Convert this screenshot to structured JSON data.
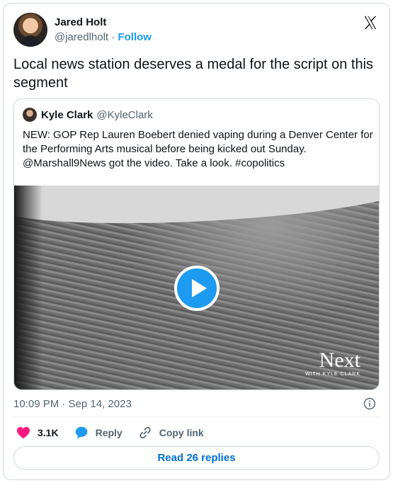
{
  "tweet": {
    "author": {
      "display_name": "Jared Holt",
      "handle": "@jaredlholt",
      "follow_label": "Follow"
    },
    "text": "Local news station deserves a medal for the script on this segment",
    "timestamp": "10:09 PM · Sep 14, 2023",
    "stats": {
      "likes": "3.1K",
      "reply_label": "Reply",
      "copy_label": "Copy link"
    },
    "read_replies_label": "Read 26 replies"
  },
  "quote": {
    "display_name": "Kyle Clark",
    "handle": "@KyleClark",
    "text": "NEW: GOP Rep Lauren Boebert denied vaping during a Denver Center for the Performing Arts musical before being kicked out Sunday. @Marshall9News got the video. Take a look. #copolitics",
    "video_watermark": "Next",
    "video_watermark_sub": "WITH KYLE CLARK"
  },
  "icons": {
    "brand": "x-logo-icon",
    "info": "info-icon",
    "like": "heart-icon",
    "reply": "speech-bubble-icon",
    "copy": "link-icon",
    "play": "play-icon"
  },
  "colors": {
    "accent": "#1d9bf0",
    "link": "#006fd6",
    "heart": "#f91880",
    "muted": "#536471",
    "border": "#cfd9de"
  }
}
